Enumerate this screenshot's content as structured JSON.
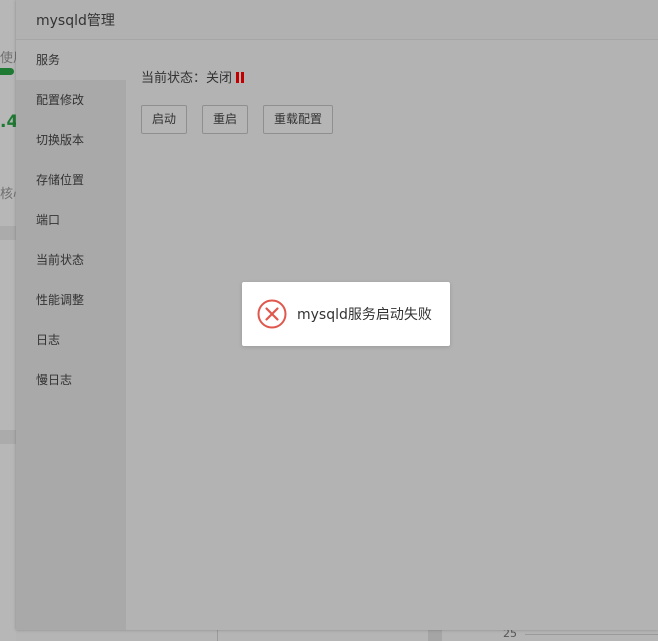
{
  "background": {
    "usage_fragment": "使用",
    "percent_fragment": ".4",
    "core_fragment": "核心",
    "axis_tick": "25"
  },
  "window": {
    "title": "mysqld管理"
  },
  "sidebar": {
    "items": [
      {
        "label": "服务",
        "active": true
      },
      {
        "label": "配置修改",
        "active": false
      },
      {
        "label": "切换版本",
        "active": false
      },
      {
        "label": "存储位置",
        "active": false
      },
      {
        "label": "端口",
        "active": false
      },
      {
        "label": "当前状态",
        "active": false
      },
      {
        "label": "性能调整",
        "active": false
      },
      {
        "label": "日志",
        "active": false
      },
      {
        "label": "慢日志",
        "active": false
      }
    ]
  },
  "service": {
    "status_label": "当前状态：",
    "status_value": "关闭",
    "status_icon": "pause-icon",
    "status_color": "#c00000",
    "buttons": {
      "start": "启动",
      "restart": "重启",
      "reload": "重载配置"
    }
  },
  "toast": {
    "icon": "error-circle-icon",
    "icon_color": "#e0574c",
    "message": "mysqld服务启动失败"
  }
}
